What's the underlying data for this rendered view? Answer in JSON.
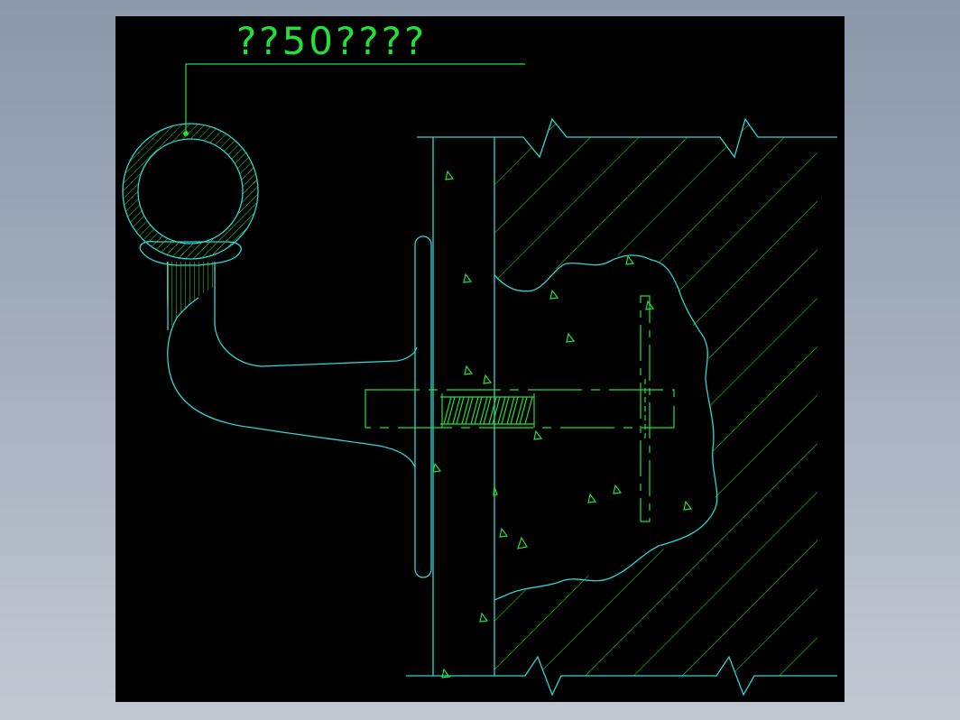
{
  "drawing": {
    "label": "??50????",
    "colors": {
      "background": "#000000",
      "outline": "#2fd6d6",
      "hatch": "#22e03a",
      "frame_gradient_top": "#8a98aa",
      "frame_gradient_bottom": "#c3c9d3"
    }
  }
}
